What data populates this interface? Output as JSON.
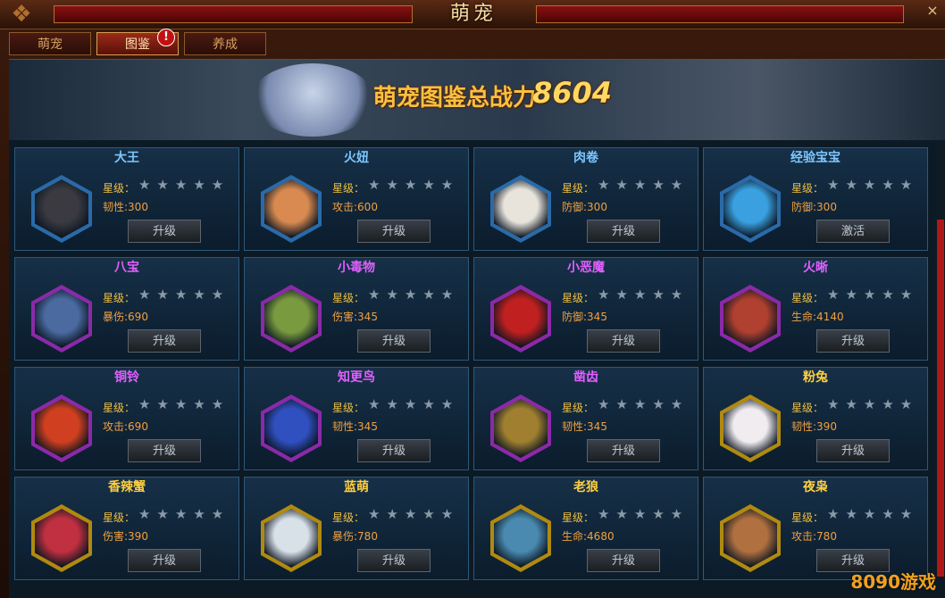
{
  "window": {
    "title": "萌宠",
    "close": "×"
  },
  "tabs": [
    {
      "label": "萌宠",
      "active": false
    },
    {
      "label": "图鉴",
      "active": true
    },
    {
      "label": "养成",
      "active": false
    }
  ],
  "badge": "!",
  "banner": {
    "label": "萌宠图鉴总战力",
    "value": "8604"
  },
  "star_label": "星级：",
  "stars": "★★★★★",
  "pets": [
    {
      "name": "大王",
      "stat": "韧性:300",
      "button": "升级",
      "name_color": "#7ec8ff",
      "frame_color": "#2a6aa8",
      "body_color": "#3a3a40"
    },
    {
      "name": "火妞",
      "stat": "攻击:600",
      "button": "升级",
      "name_color": "#7ec8ff",
      "frame_color": "#2a6aa8",
      "body_color": "#d88a50"
    },
    {
      "name": "肉卷",
      "stat": "防御:300",
      "button": "升级",
      "name_color": "#7ec8ff",
      "frame_color": "#2a6aa8",
      "body_color": "#e8e4dc"
    },
    {
      "name": "经验宝宝",
      "stat": "防御:300",
      "button": "激活",
      "name_color": "#7ec8ff",
      "frame_color": "#2a6aa8",
      "body_color": "#3aa0e0"
    },
    {
      "name": "八宝",
      "stat": "暴伤:690",
      "button": "升级",
      "name_color": "#e060ff",
      "frame_color": "#8a2aa8",
      "body_color": "#4a6aa0"
    },
    {
      "name": "小毒物",
      "stat": "伤害:345",
      "button": "升级",
      "name_color": "#e060ff",
      "frame_color": "#8a2aa8",
      "body_color": "#7a9a40"
    },
    {
      "name": "小恶魔",
      "stat": "防御:345",
      "button": "升级",
      "name_color": "#e060ff",
      "frame_color": "#8a2aa8",
      "body_color": "#c02020"
    },
    {
      "name": "火晰",
      "stat": "生命:4140",
      "button": "升级",
      "name_color": "#e060ff",
      "frame_color": "#8a2aa8",
      "body_color": "#b04030"
    },
    {
      "name": "铜铃",
      "stat": "攻击:690",
      "button": "升级",
      "name_color": "#e060ff",
      "frame_color": "#8a2aa8",
      "body_color": "#d04020"
    },
    {
      "name": "知更鸟",
      "stat": "韧性:345",
      "button": "升级",
      "name_color": "#e060ff",
      "frame_color": "#8a2aa8",
      "body_color": "#3050c0"
    },
    {
      "name": "凿齿",
      "stat": "韧性:345",
      "button": "升级",
      "name_color": "#e060ff",
      "frame_color": "#8a2aa8",
      "body_color": "#a08030"
    },
    {
      "name": "粉兔",
      "stat": "韧性:390",
      "button": "升级",
      "name_color": "#ffd040",
      "frame_color": "#b08a10",
      "body_color": "#f0ecf0"
    },
    {
      "name": "香辣蟹",
      "stat": "伤害:390",
      "button": "升级",
      "name_color": "#ffd040",
      "frame_color": "#b08a10",
      "body_color": "#c03040"
    },
    {
      "name": "蓝萌",
      "stat": "暴伤:780",
      "button": "升级",
      "name_color": "#ffd040",
      "frame_color": "#b08a10",
      "body_color": "#d8e0e8"
    },
    {
      "name": "老狼",
      "stat": "生命:4680",
      "button": "升级",
      "name_color": "#ffd040",
      "frame_color": "#b08a10",
      "body_color": "#4a8ab0"
    },
    {
      "name": "夜枭",
      "stat": "攻击:780",
      "button": "升级",
      "name_color": "#ffd040",
      "frame_color": "#b08a10",
      "body_color": "#b07040"
    }
  ],
  "watermark": "8090游戏"
}
